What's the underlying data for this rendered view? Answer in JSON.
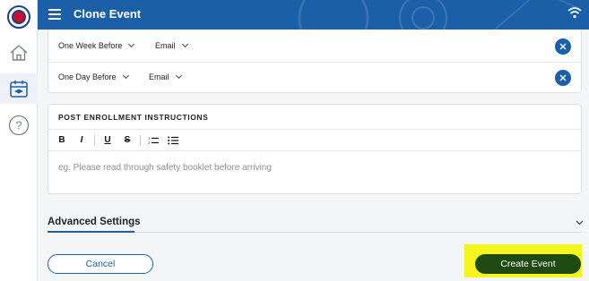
{
  "header": {
    "title": "Clone Event"
  },
  "sidebar": {
    "items": [
      {
        "icon": "home-icon"
      },
      {
        "icon": "calendar-icon",
        "active": true
      },
      {
        "icon": "help-icon"
      }
    ]
  },
  "reminders": [
    {
      "timing": "One Week Before",
      "method": "Email"
    },
    {
      "timing": "One Day Before",
      "method": "Email"
    }
  ],
  "instructions": {
    "title": "POST ENROLLMENT INSTRUCTIONS",
    "toolbar": [
      "B",
      "I",
      "U",
      "S"
    ],
    "placeholder": "eg. Please read through safety booklet before arriving"
  },
  "advanced": {
    "label": "Advanced Settings"
  },
  "actions": {
    "cancel_label": "Cancel",
    "create_label": "Create Event"
  },
  "colors": {
    "primary": "#1b5fa8",
    "create": "#1f4a11",
    "highlight": "#f3f51c"
  }
}
